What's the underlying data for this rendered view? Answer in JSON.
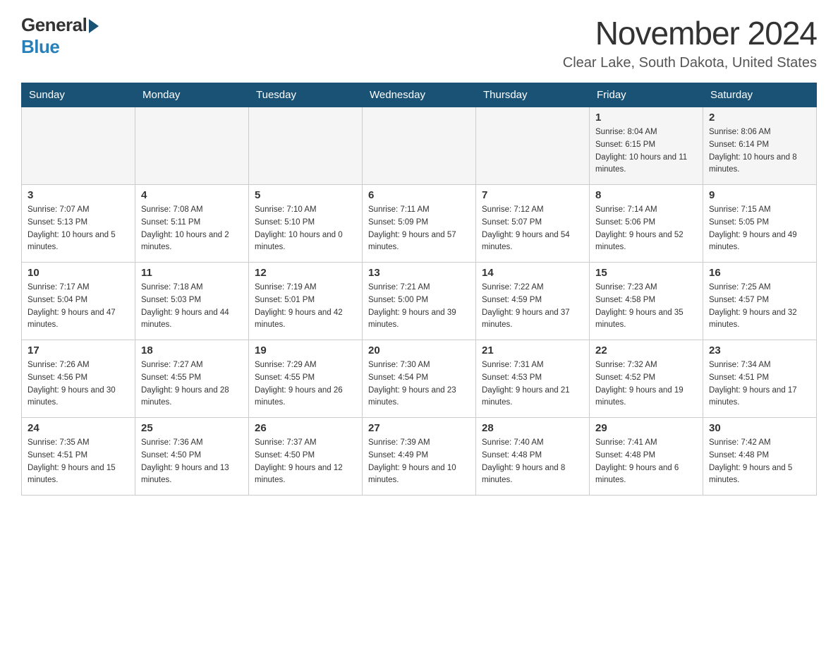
{
  "logo": {
    "general": "General",
    "blue": "Blue"
  },
  "title": {
    "month": "November 2024",
    "location": "Clear Lake, South Dakota, United States"
  },
  "days_of_week": [
    "Sunday",
    "Monday",
    "Tuesday",
    "Wednesday",
    "Thursday",
    "Friday",
    "Saturday"
  ],
  "weeks": [
    [
      {
        "day": "",
        "sunrise": "",
        "sunset": "",
        "daylight": ""
      },
      {
        "day": "",
        "sunrise": "",
        "sunset": "",
        "daylight": ""
      },
      {
        "day": "",
        "sunrise": "",
        "sunset": "",
        "daylight": ""
      },
      {
        "day": "",
        "sunrise": "",
        "sunset": "",
        "daylight": ""
      },
      {
        "day": "",
        "sunrise": "",
        "sunset": "",
        "daylight": ""
      },
      {
        "day": "1",
        "sunrise": "Sunrise: 8:04 AM",
        "sunset": "Sunset: 6:15 PM",
        "daylight": "Daylight: 10 hours and 11 minutes."
      },
      {
        "day": "2",
        "sunrise": "Sunrise: 8:06 AM",
        "sunset": "Sunset: 6:14 PM",
        "daylight": "Daylight: 10 hours and 8 minutes."
      }
    ],
    [
      {
        "day": "3",
        "sunrise": "Sunrise: 7:07 AM",
        "sunset": "Sunset: 5:13 PM",
        "daylight": "Daylight: 10 hours and 5 minutes."
      },
      {
        "day": "4",
        "sunrise": "Sunrise: 7:08 AM",
        "sunset": "Sunset: 5:11 PM",
        "daylight": "Daylight: 10 hours and 2 minutes."
      },
      {
        "day": "5",
        "sunrise": "Sunrise: 7:10 AM",
        "sunset": "Sunset: 5:10 PM",
        "daylight": "Daylight: 10 hours and 0 minutes."
      },
      {
        "day": "6",
        "sunrise": "Sunrise: 7:11 AM",
        "sunset": "Sunset: 5:09 PM",
        "daylight": "Daylight: 9 hours and 57 minutes."
      },
      {
        "day": "7",
        "sunrise": "Sunrise: 7:12 AM",
        "sunset": "Sunset: 5:07 PM",
        "daylight": "Daylight: 9 hours and 54 minutes."
      },
      {
        "day": "8",
        "sunrise": "Sunrise: 7:14 AM",
        "sunset": "Sunset: 5:06 PM",
        "daylight": "Daylight: 9 hours and 52 minutes."
      },
      {
        "day": "9",
        "sunrise": "Sunrise: 7:15 AM",
        "sunset": "Sunset: 5:05 PM",
        "daylight": "Daylight: 9 hours and 49 minutes."
      }
    ],
    [
      {
        "day": "10",
        "sunrise": "Sunrise: 7:17 AM",
        "sunset": "Sunset: 5:04 PM",
        "daylight": "Daylight: 9 hours and 47 minutes."
      },
      {
        "day": "11",
        "sunrise": "Sunrise: 7:18 AM",
        "sunset": "Sunset: 5:03 PM",
        "daylight": "Daylight: 9 hours and 44 minutes."
      },
      {
        "day": "12",
        "sunrise": "Sunrise: 7:19 AM",
        "sunset": "Sunset: 5:01 PM",
        "daylight": "Daylight: 9 hours and 42 minutes."
      },
      {
        "day": "13",
        "sunrise": "Sunrise: 7:21 AM",
        "sunset": "Sunset: 5:00 PM",
        "daylight": "Daylight: 9 hours and 39 minutes."
      },
      {
        "day": "14",
        "sunrise": "Sunrise: 7:22 AM",
        "sunset": "Sunset: 4:59 PM",
        "daylight": "Daylight: 9 hours and 37 minutes."
      },
      {
        "day": "15",
        "sunrise": "Sunrise: 7:23 AM",
        "sunset": "Sunset: 4:58 PM",
        "daylight": "Daylight: 9 hours and 35 minutes."
      },
      {
        "day": "16",
        "sunrise": "Sunrise: 7:25 AM",
        "sunset": "Sunset: 4:57 PM",
        "daylight": "Daylight: 9 hours and 32 minutes."
      }
    ],
    [
      {
        "day": "17",
        "sunrise": "Sunrise: 7:26 AM",
        "sunset": "Sunset: 4:56 PM",
        "daylight": "Daylight: 9 hours and 30 minutes."
      },
      {
        "day": "18",
        "sunrise": "Sunrise: 7:27 AM",
        "sunset": "Sunset: 4:55 PM",
        "daylight": "Daylight: 9 hours and 28 minutes."
      },
      {
        "day": "19",
        "sunrise": "Sunrise: 7:29 AM",
        "sunset": "Sunset: 4:55 PM",
        "daylight": "Daylight: 9 hours and 26 minutes."
      },
      {
        "day": "20",
        "sunrise": "Sunrise: 7:30 AM",
        "sunset": "Sunset: 4:54 PM",
        "daylight": "Daylight: 9 hours and 23 minutes."
      },
      {
        "day": "21",
        "sunrise": "Sunrise: 7:31 AM",
        "sunset": "Sunset: 4:53 PM",
        "daylight": "Daylight: 9 hours and 21 minutes."
      },
      {
        "day": "22",
        "sunrise": "Sunrise: 7:32 AM",
        "sunset": "Sunset: 4:52 PM",
        "daylight": "Daylight: 9 hours and 19 minutes."
      },
      {
        "day": "23",
        "sunrise": "Sunrise: 7:34 AM",
        "sunset": "Sunset: 4:51 PM",
        "daylight": "Daylight: 9 hours and 17 minutes."
      }
    ],
    [
      {
        "day": "24",
        "sunrise": "Sunrise: 7:35 AM",
        "sunset": "Sunset: 4:51 PM",
        "daylight": "Daylight: 9 hours and 15 minutes."
      },
      {
        "day": "25",
        "sunrise": "Sunrise: 7:36 AM",
        "sunset": "Sunset: 4:50 PM",
        "daylight": "Daylight: 9 hours and 13 minutes."
      },
      {
        "day": "26",
        "sunrise": "Sunrise: 7:37 AM",
        "sunset": "Sunset: 4:50 PM",
        "daylight": "Daylight: 9 hours and 12 minutes."
      },
      {
        "day": "27",
        "sunrise": "Sunrise: 7:39 AM",
        "sunset": "Sunset: 4:49 PM",
        "daylight": "Daylight: 9 hours and 10 minutes."
      },
      {
        "day": "28",
        "sunrise": "Sunrise: 7:40 AM",
        "sunset": "Sunset: 4:48 PM",
        "daylight": "Daylight: 9 hours and 8 minutes."
      },
      {
        "day": "29",
        "sunrise": "Sunrise: 7:41 AM",
        "sunset": "Sunset: 4:48 PM",
        "daylight": "Daylight: 9 hours and 6 minutes."
      },
      {
        "day": "30",
        "sunrise": "Sunrise: 7:42 AM",
        "sunset": "Sunset: 4:48 PM",
        "daylight": "Daylight: 9 hours and 5 minutes."
      }
    ]
  ]
}
